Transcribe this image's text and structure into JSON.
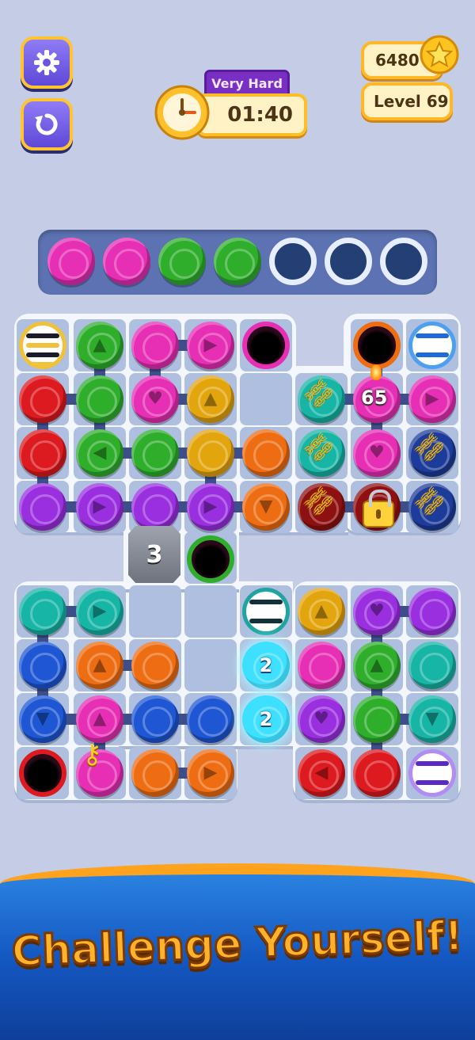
{
  "hud": {
    "settings_icon": "gear-icon",
    "restart_icon": "restart-icon",
    "difficulty": "Very Hard",
    "timer": "01:40",
    "coins": "6480",
    "level": "Level 69"
  },
  "colors": {
    "magenta": "#e62fb4",
    "green": "#2fae2c",
    "red": "#dc1a1f",
    "purple": "#9a2fe0",
    "yellow": "#e3a50e",
    "orange": "#ee6d12",
    "teal": "#17b5a6",
    "blue": "#1e56d4",
    "darkred": "#8e1010",
    "navy": "#1d3b9a",
    "cyan": "#3ee0ff"
  },
  "tray": {
    "slots": [
      "magenta",
      "magenta",
      "green",
      "green",
      "empty",
      "empty",
      "empty"
    ]
  },
  "board": {
    "top_counter": "65",
    "stone_counter": "3",
    "glow_ball_counter_1": "2",
    "glow_ball_counter_2": "2"
  },
  "banner": {
    "text": "Challenge Yourself!"
  }
}
